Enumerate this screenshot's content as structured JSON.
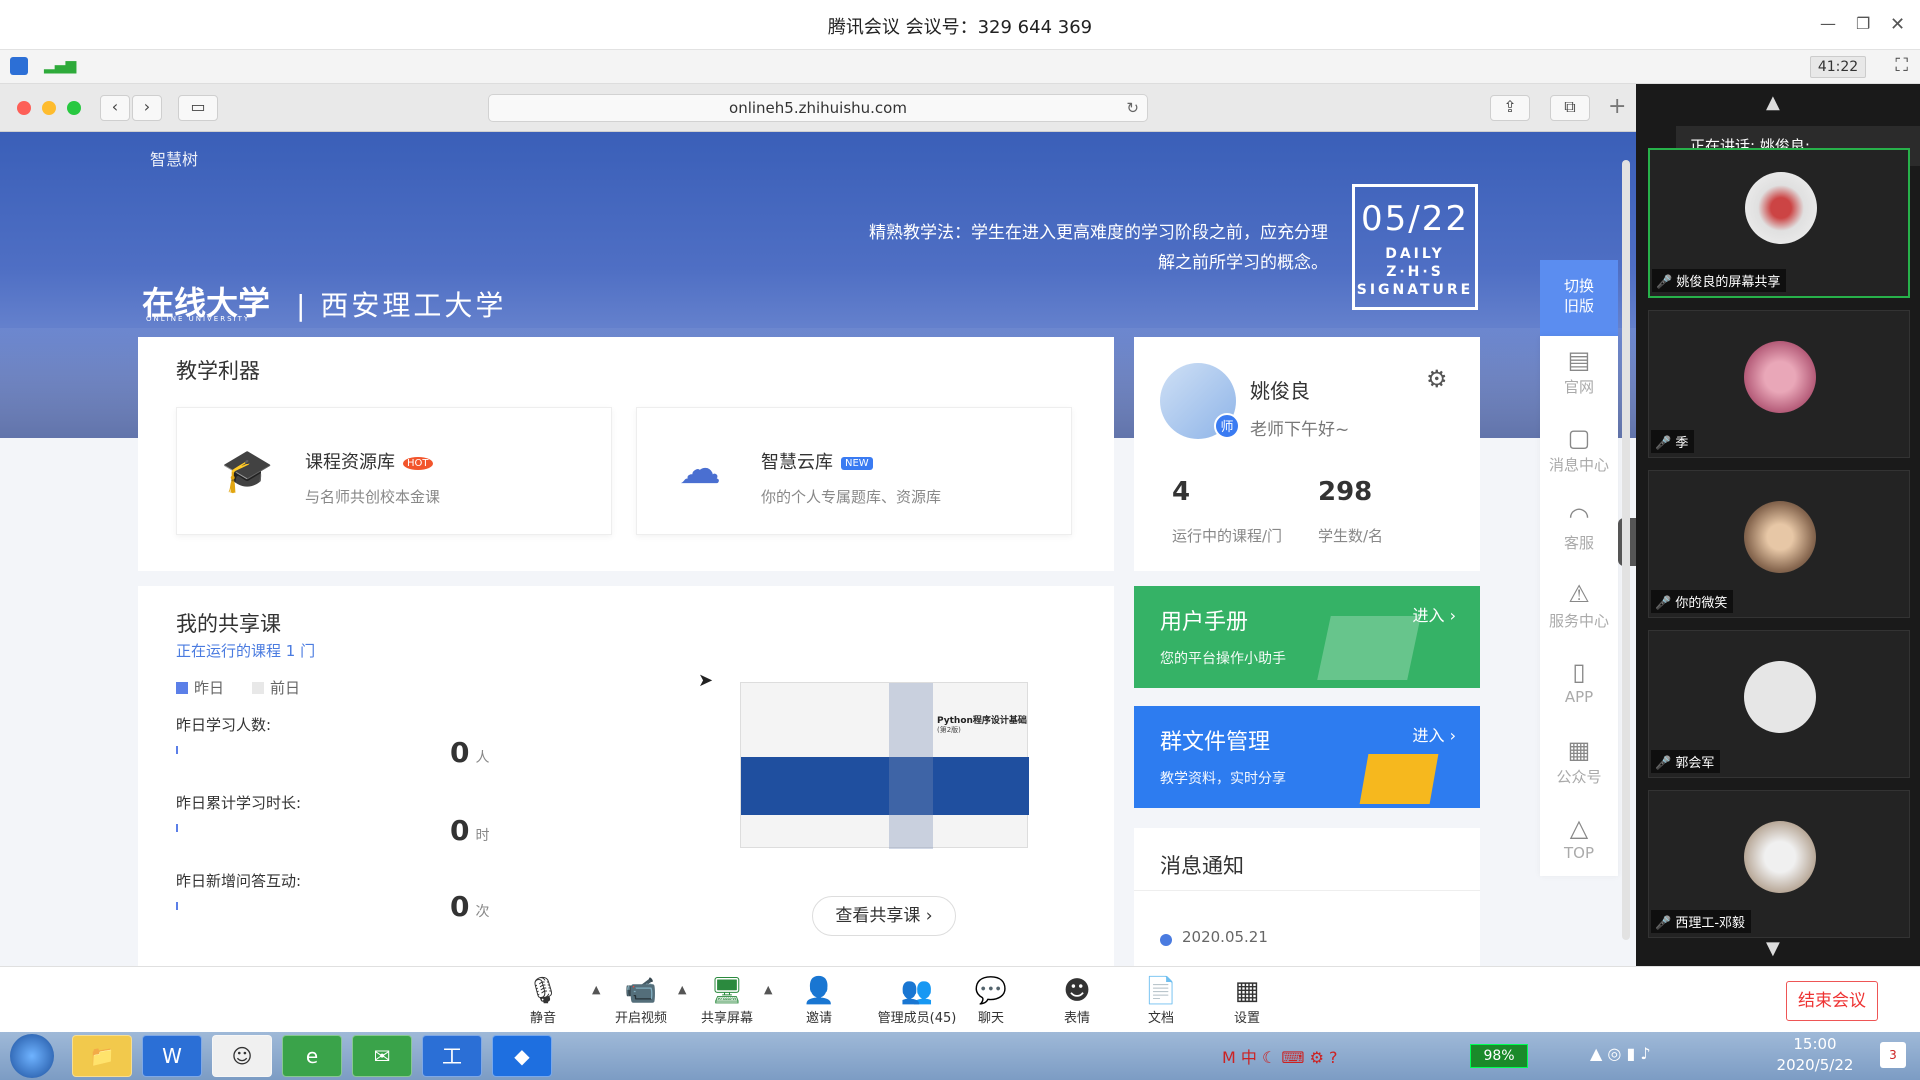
{
  "meeting": {
    "title": "腾讯会议 会议号：329 644 369",
    "timer": "41:22"
  },
  "browser": {
    "url": "onlineh5.zhihuishu.com"
  },
  "hero": {
    "logo_top": "智慧树",
    "logo_main": "在线大学",
    "logo_sub_en": "ONLINE UNIVERSITY",
    "school": "| 西安理工大学",
    "quote_line1": "精熟教学法：学生在进入更高难度的学习阶段之前，应充分理",
    "quote_line2": "解之前所学习的概念。",
    "daily_date": "05/22",
    "daily_line1": "DAILY Z·H·S",
    "daily_line2": "SIGNATURE"
  },
  "tools": {
    "heading": "教学利器",
    "items": [
      {
        "title": "课程资源库",
        "tag": "HOT",
        "desc": "与名师共创校本金课"
      },
      {
        "title": "智慧云库",
        "tag": "NEW",
        "desc": "你的个人专属题库、资源库"
      }
    ]
  },
  "profile": {
    "name": "姚俊良",
    "greeting": "老师下午好~",
    "badge": "师",
    "courses_value": "4",
    "courses_label": "运行中的课程/门",
    "students_value": "298",
    "students_label": "学生数/名"
  },
  "shared": {
    "heading": "我的共享课",
    "running": "正在运行的课程 1 门",
    "legend_yesterday": "昨日",
    "legend_before": "前日",
    "stats": [
      {
        "label": "昨日学习人数:",
        "value": "0",
        "unit": "人"
      },
      {
        "label": "昨日累计学习时长:",
        "value": "0",
        "unit": "时"
      },
      {
        "label": "昨日新增问答互动:",
        "value": "0",
        "unit": "次"
      }
    ],
    "book_title": "Python程序设计基础",
    "book_edition": "(第2版)",
    "view_button": "查看共享课"
  },
  "banners": {
    "manual_title": "用户手册",
    "manual_desc": "您的平台操作小助手",
    "manual_enter": "进入 ›",
    "files_title": "群文件管理",
    "files_desc": "教学资料，实时分享",
    "files_enter": "进入 ›"
  },
  "notice": {
    "heading": "消息通知",
    "date": "2020.05.21"
  },
  "sidebar": {
    "switch": "切换旧版",
    "items": [
      "官网",
      "消息中心",
      "客服",
      "服务中心",
      "APP",
      "公众号",
      "TOP"
    ]
  },
  "participants": {
    "speaking": "正在讲话: 姚俊良;",
    "tiles": [
      {
        "name": "姚俊良的屏幕共享"
      },
      {
        "name": "季"
      },
      {
        "name": "你的微笑"
      },
      {
        "name": "郭会军"
      },
      {
        "name": "西理工-邓毅"
      }
    ]
  },
  "toolbar": {
    "mute": "静音",
    "video": "开启视频",
    "share": "共享屏幕",
    "invite": "邀请",
    "members": "管理成员(45)",
    "chat": "聊天",
    "emoji": "表情",
    "docs": "文档",
    "settings": "设置",
    "end": "结束会议"
  },
  "taskbar": {
    "battery": "98%",
    "time": "15:00",
    "date": "2020/5/22",
    "notify": "3"
  }
}
